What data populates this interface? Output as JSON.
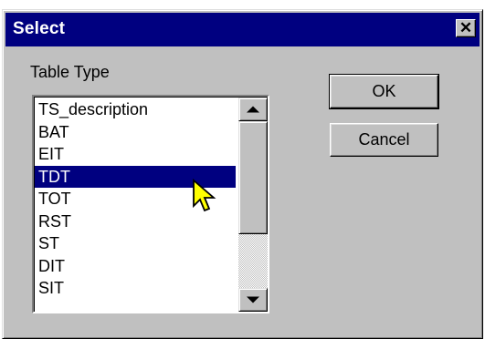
{
  "window": {
    "title": "Select",
    "close_symbol": "✕"
  },
  "table_type": {
    "label": "Table Type",
    "items": [
      "TS_description",
      "BAT",
      "EIT",
      "TDT",
      "TOT",
      "RST",
      "ST",
      "DIT",
      "SIT"
    ],
    "selected": "TDT"
  },
  "buttons": {
    "ok": "OK",
    "cancel": "Cancel"
  },
  "icons": {
    "scroll_up": "scroll-up-arrow-icon",
    "scroll_down": "scroll-down-arrow-icon",
    "cursor": "arrow-pointer-cursor-icon"
  },
  "colors": {
    "titlebar": "#000080",
    "selection": "#000080",
    "face": "#c0c0c0",
    "cursor_fill": "#ffff00"
  }
}
